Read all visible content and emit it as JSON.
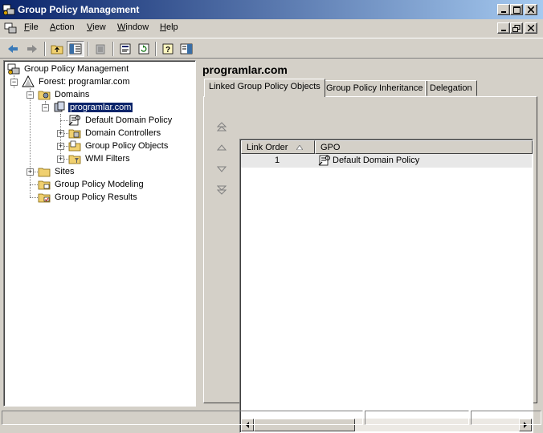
{
  "window": {
    "title": "Group Policy Management"
  },
  "menu": {
    "items": [
      {
        "label": "File"
      },
      {
        "label": "Action"
      },
      {
        "label": "View"
      },
      {
        "label": "Window"
      },
      {
        "label": "Help"
      }
    ]
  },
  "tree": {
    "root": "Group Policy Management",
    "forest": "Forest: programlar.com",
    "domains": "Domains",
    "domain": "programlar.com",
    "children": [
      "Default Domain Policy",
      "Domain Controllers",
      "Group Policy Objects",
      "WMI Filters"
    ],
    "sites": "Sites",
    "modeling": "Group Policy Modeling",
    "results": "Group Policy Results"
  },
  "details": {
    "title": "programlar.com",
    "tabs": [
      {
        "label": "Linked Group Policy Objects",
        "active": true
      },
      {
        "label": "Group Policy Inheritance",
        "active": false
      },
      {
        "label": "Delegation",
        "active": false
      }
    ],
    "columns": [
      "Link Order",
      "GPO"
    ],
    "rows": [
      {
        "link_order": "1",
        "gpo": "Default Domain Policy"
      }
    ]
  },
  "colors": {
    "title_start": "#0a246a",
    "title_end": "#a6caf0",
    "selection": "#0a246a",
    "face": "#d4d0c8"
  }
}
